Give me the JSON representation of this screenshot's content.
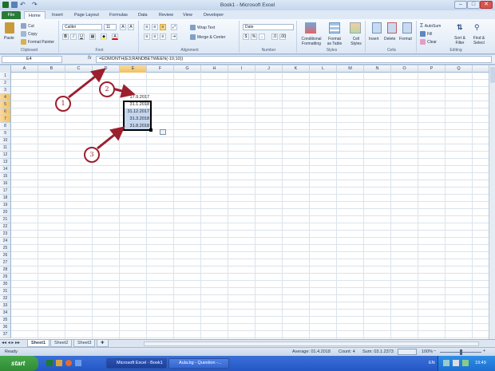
{
  "window": {
    "title": "Book1 - Microsoft Excel",
    "minimize": "–",
    "maximize": "□",
    "close": "✕"
  },
  "ribbon_tabs": [
    "File",
    "Home",
    "Insert",
    "Page Layout",
    "Formulas",
    "Data",
    "Review",
    "View",
    "Developer"
  ],
  "clipboard": {
    "paste": "Paste",
    "cut": "Cut",
    "copy": "Copy",
    "format_painter": "Format Painter",
    "label": "Clipboard"
  },
  "font": {
    "name": "Calibri",
    "size": "11",
    "label": "Font"
  },
  "alignment": {
    "wrap_text": "Wrap Text",
    "merge_center": "Merge & Center",
    "label": "Alignment"
  },
  "number": {
    "format": "Date",
    "label": "Number"
  },
  "styles": {
    "conditional": "Conditional",
    "formatting": "Formatting",
    "format_as": "Format",
    "as_table": "as Table",
    "cell": "Cell",
    "cell_styles": "Styles",
    "label": "Styles"
  },
  "cells": {
    "insert": "Insert",
    "delete": "Delete",
    "format": "Format",
    "label": "Cells"
  },
  "editing": {
    "autosum": "AutoSum",
    "fill": "Fill",
    "clear": "Clear",
    "sort": "Sort &",
    "filter": "Filter",
    "find": "Find &",
    "select": "Select",
    "label": "Editing"
  },
  "formula_bar": {
    "name_box": "E4",
    "fx": "fx",
    "formula": "=EOMONTH(E3;RANDBETWEEN(-10;10))"
  },
  "columns": [
    "A",
    "B",
    "C",
    "D",
    "E",
    "F",
    "G",
    "H",
    "I",
    "J",
    "K",
    "L",
    "M",
    "N",
    "O",
    "P",
    "Q"
  ],
  "rows": [
    "1",
    "2",
    "3",
    "4",
    "5",
    "6",
    "7",
    "8",
    "9",
    "10",
    "11",
    "12",
    "13",
    "14",
    "15",
    "16",
    "17",
    "18",
    "19",
    "20",
    "21",
    "22",
    "23",
    "24",
    "25",
    "26",
    "27",
    "28",
    "29",
    "30",
    "31",
    "32",
    "33",
    "34",
    "35",
    "36",
    "37"
  ],
  "cells_data": {
    "E3": "17.9.2017",
    "E4": "31.1.2018",
    "E5": "31.12.2017",
    "E6": "31.3.2018",
    "E7": "31.8.2018"
  },
  "annotations": [
    "1",
    "2",
    "3"
  ],
  "sheets": [
    "Sheet1",
    "Sheet2",
    "Sheet3"
  ],
  "status": {
    "ready": "Ready",
    "average": "Average: 01.4.2018",
    "count": "Count: 4",
    "sum": "Sum: 03.1.2373",
    "zoom": "100%",
    "zoom_minus": "–",
    "zoom_plus": "+"
  },
  "taskbar": {
    "start": "start",
    "tasks": [
      "Microsoft Excel - Book1",
      "Aula.bg - Question -..."
    ],
    "lang": "EN",
    "clock": "19:49"
  },
  "colors": {
    "accent_green": "#2a7a39",
    "selection": "#c5d6ef",
    "annotation": "#9c1f2e",
    "taskbar": "#2457c5"
  }
}
